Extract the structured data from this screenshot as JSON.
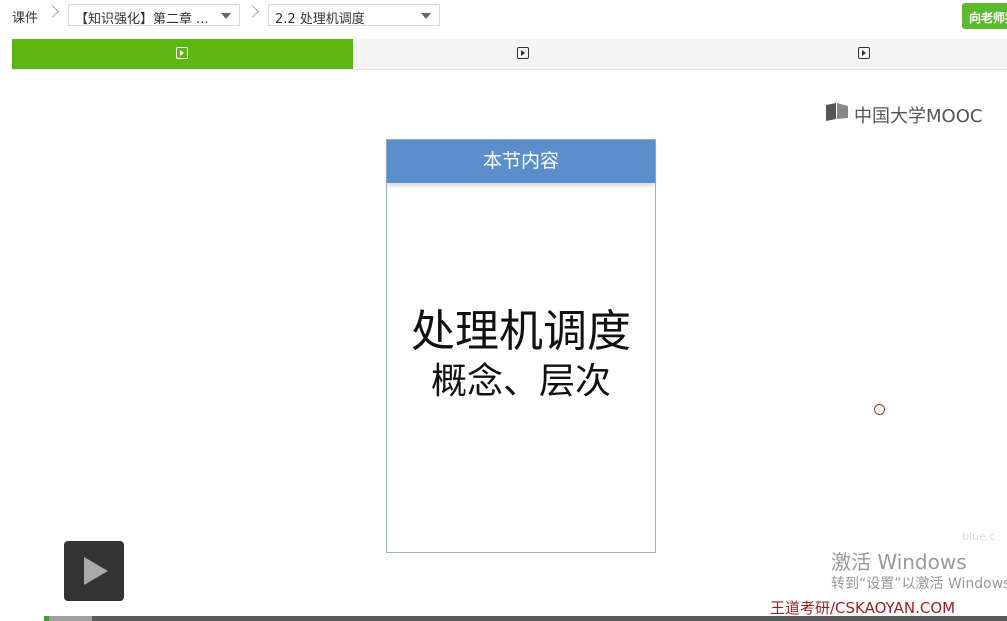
{
  "breadcrumb": {
    "root_label": "课件",
    "chapter_select": "【知识强化】第二章 ...",
    "section_select": "2.2 处理机调度"
  },
  "header": {
    "ask_teacher_label": "向老师提问"
  },
  "tabs": [
    {
      "icon": "play-square-icon",
      "active": true
    },
    {
      "icon": "play-square-icon",
      "active": false
    },
    {
      "icon": "play-square-icon",
      "active": false
    }
  ],
  "video": {
    "logo_text": "中国大学MOOC",
    "slide": {
      "header": "本节内容",
      "title": "处理机调度",
      "subtitle": "概念、层次"
    },
    "faint_text": "blue.c",
    "watermark": "王道考研/CSKAOYAN.COM",
    "progress_fraction": 0.005,
    "buffer_fraction": 0.05
  },
  "windows_activation": {
    "title": "激活 Windows",
    "subtitle": "转到“设置”以激活 Windows"
  },
  "colors": {
    "accent_green": "#5cb810",
    "slide_header_blue": "#5b8fcb",
    "watermark_red": "#9b2222"
  }
}
